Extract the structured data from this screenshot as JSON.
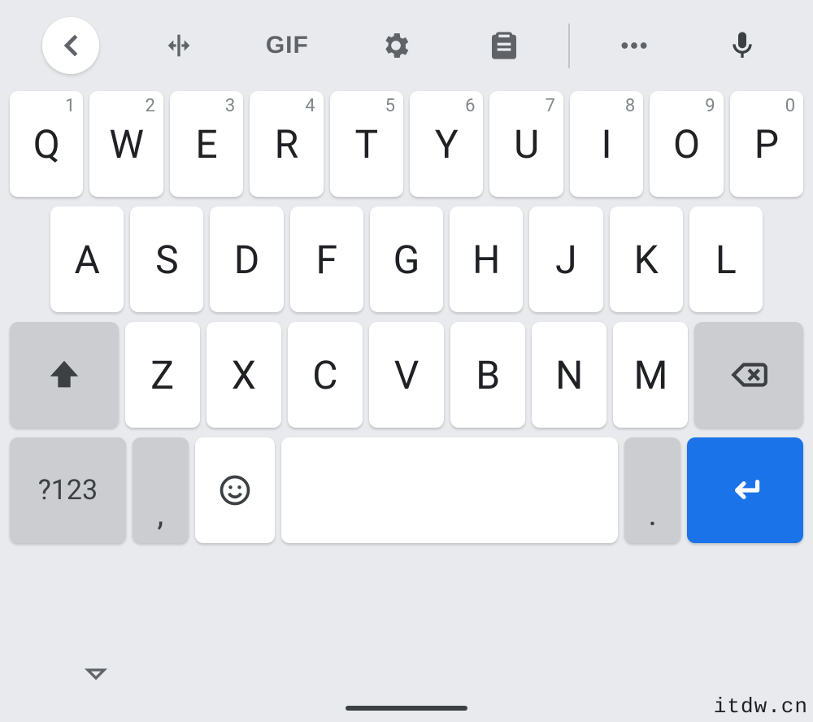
{
  "toolbar": {
    "gif_label": "GIF"
  },
  "rows": {
    "r1": [
      {
        "letter": "Q",
        "hint": "1"
      },
      {
        "letter": "W",
        "hint": "2"
      },
      {
        "letter": "E",
        "hint": "3"
      },
      {
        "letter": "R",
        "hint": "4"
      },
      {
        "letter": "T",
        "hint": "5"
      },
      {
        "letter": "Y",
        "hint": "6"
      },
      {
        "letter": "U",
        "hint": "7"
      },
      {
        "letter": "I",
        "hint": "8"
      },
      {
        "letter": "O",
        "hint": "9"
      },
      {
        "letter": "P",
        "hint": "0"
      }
    ],
    "r2": [
      {
        "letter": "A"
      },
      {
        "letter": "S"
      },
      {
        "letter": "D"
      },
      {
        "letter": "F"
      },
      {
        "letter": "G"
      },
      {
        "letter": "H"
      },
      {
        "letter": "J"
      },
      {
        "letter": "K"
      },
      {
        "letter": "L"
      }
    ],
    "r3": [
      {
        "letter": "Z"
      },
      {
        "letter": "X"
      },
      {
        "letter": "C"
      },
      {
        "letter": "V"
      },
      {
        "letter": "B"
      },
      {
        "letter": "N"
      },
      {
        "letter": "M"
      }
    ]
  },
  "bottom": {
    "symbols_label": "?123",
    "comma": ",",
    "period": "."
  },
  "watermark": "itdw.cn"
}
